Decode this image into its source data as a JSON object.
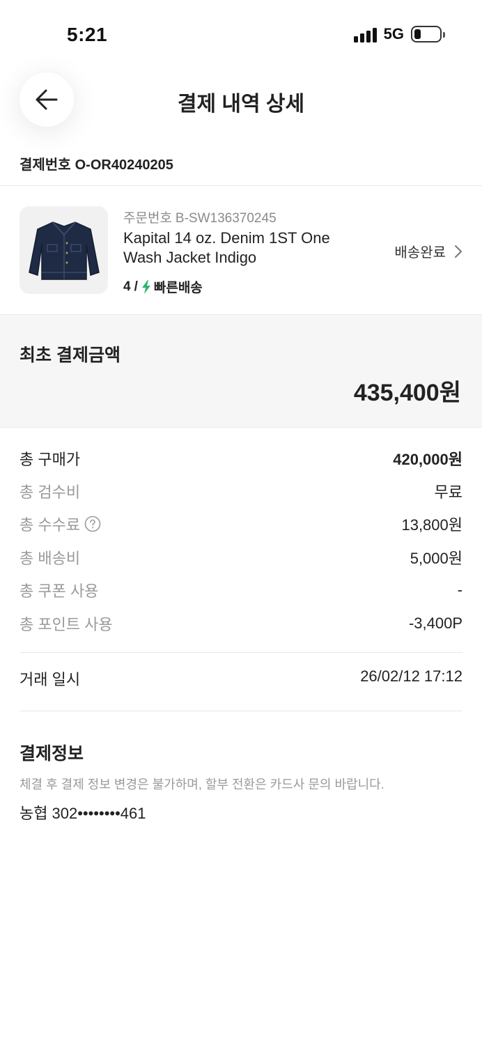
{
  "status_bar": {
    "time": "5:21",
    "network": "5G",
    "battery_level": 0.25
  },
  "nav": {
    "back_icon": "arrow-left-icon",
    "title": "결제 내역 상세"
  },
  "payment": {
    "number_label": "결제번호",
    "number": "O-OR40240205"
  },
  "order": {
    "number_label": "주문번호",
    "number": "B-SW136370245",
    "product_name": "Kapital 14 oz. Denim 1ST One Wash Jacket Indigo",
    "size": "4",
    "separator": "/",
    "shipping_icon": "lightning-icon",
    "shipping_type": "빠른배송",
    "status": "배송완료",
    "status_icon": "chevron-right-icon",
    "accent_color": "#31b46e"
  },
  "total": {
    "label": "최초 결제금액",
    "amount": "435,400원"
  },
  "breakdown": [
    {
      "label": "총 구매가",
      "value": "420,000원",
      "help": false
    },
    {
      "label": "총 검수비",
      "value": "무료",
      "help": false
    },
    {
      "label": "총 수수료",
      "value": "13,800원",
      "help": true
    },
    {
      "label": "총 배송비",
      "value": "5,000원",
      "help": false
    },
    {
      "label": "총 쿠폰 사용",
      "value": "-",
      "help": false
    },
    {
      "label": "총 포인트 사용",
      "value": "-3,400P",
      "help": false
    }
  ],
  "trade": {
    "label": "거래 일시",
    "datetime": "26/02/12 17:12"
  },
  "payment_info": {
    "title": "결제정보",
    "note": "체결 후 결제 정보 변경은 불가하며, 할부 전환은 카드사 문의 바랍니다.",
    "bank": "농협",
    "card_number": "302••••••••461"
  }
}
